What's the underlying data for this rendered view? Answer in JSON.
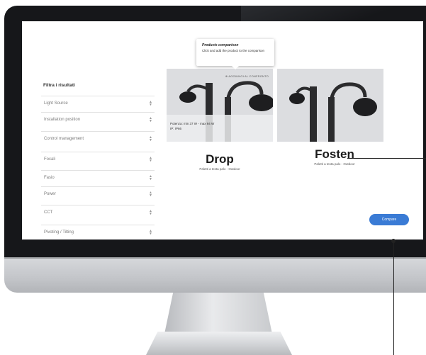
{
  "sidebar": {
    "title": "Filtra i risultati",
    "filters": [
      {
        "label": "Light Source"
      },
      {
        "label": "Installation position"
      },
      {
        "label": "Control management"
      },
      {
        "label": "Focali"
      },
      {
        "label": "Fasio"
      },
      {
        "label": "Power"
      },
      {
        "label": "CCT"
      },
      {
        "label": "Pivoting / Tilting"
      }
    ]
  },
  "tooltip": {
    "title": "Products comparison",
    "text": "Click and add the product to the comparison"
  },
  "products": [
    {
      "name": "Drop",
      "subtitle": "Paletti a testa palo - Outdoor",
      "add_compare": "AGGIUNGI AL CONFRONTO",
      "info_line1": "Potenza: min 37 W - max 94 W",
      "info_line2": "IP: IP66"
    },
    {
      "name": "Fosten",
      "subtitle": "Paletti a testa palo - Outdoor"
    }
  ],
  "compare_button": "Compare",
  "colors": {
    "accent": "#3a7bd5",
    "bezel": "#16171a",
    "product_bg": "#dcdde0"
  }
}
